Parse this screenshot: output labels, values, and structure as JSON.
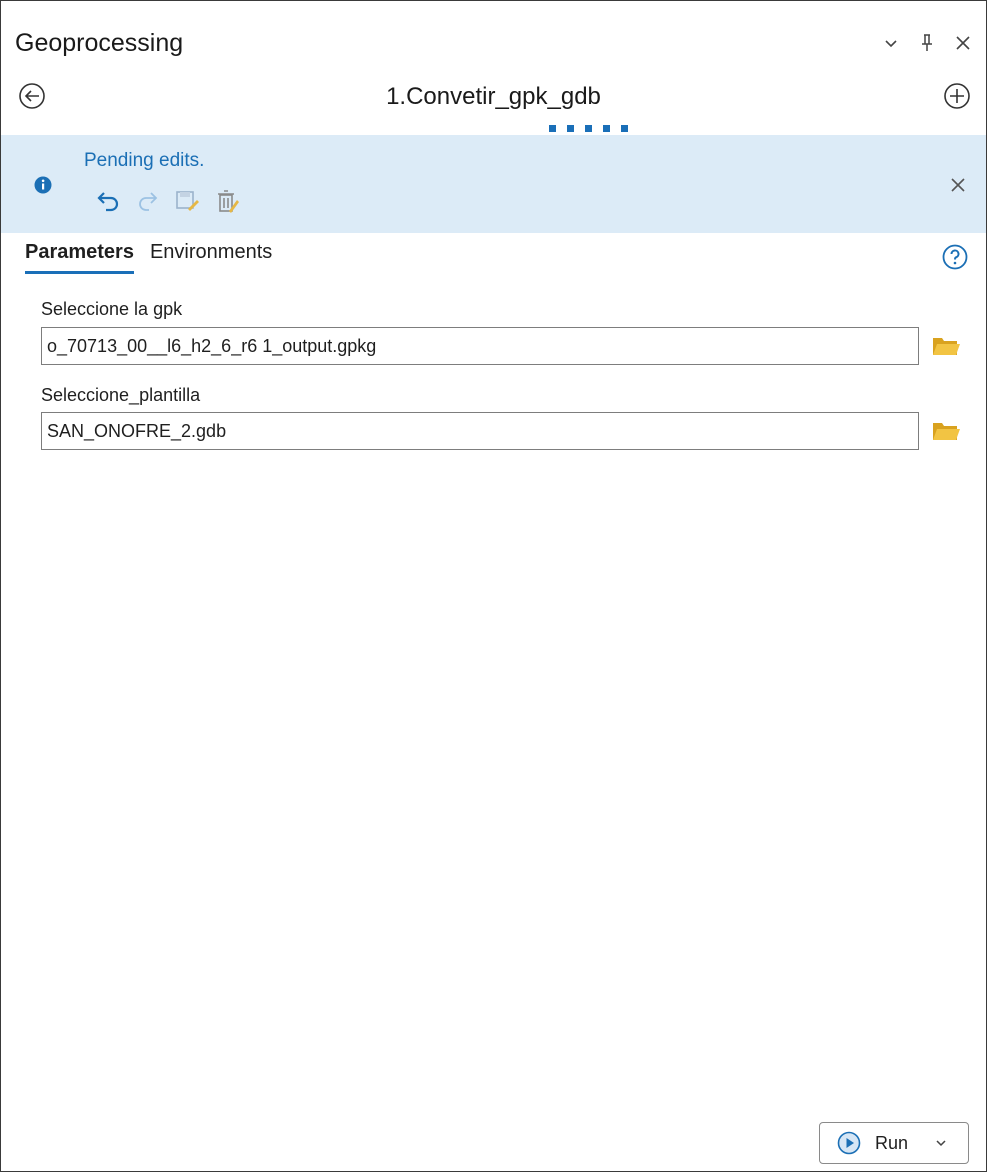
{
  "pane": {
    "title": "Geoprocessing",
    "controls": [
      {
        "icon": "chevron-down-icon",
        "glyph": "⌄"
      },
      {
        "icon": "pin-icon",
        "glyph": "⊥"
      },
      {
        "icon": "close-icon",
        "glyph": "×"
      }
    ]
  },
  "nav": {
    "tool_name": "1.Convetir_gpk_gdb",
    "back_icon": "back-arrow-icon",
    "add_icon": "add-icon"
  },
  "banner": {
    "message": "Pending edits.",
    "info_icon": "info-icon",
    "tools": [
      "undo-icon",
      "redo-icon",
      "save-edits-icon",
      "discard-edits-icon"
    ],
    "close_icon": "close-icon",
    "background": "#dcebf7",
    "text_color": "#1b6fb5"
  },
  "tabs": [
    {
      "label": "Parameters",
      "active": true
    },
    {
      "label": "Environments",
      "active": false
    }
  ],
  "help_icon": "help-icon",
  "parameters": [
    {
      "label": "Seleccione la gpk",
      "value": "o_70713_00__l6_h2_6_r6 1_output.gpkg",
      "browse_icon": "folder-icon"
    },
    {
      "label": "Seleccione_plantilla",
      "value": "SAN_ONOFRE_2.gdb",
      "browse_icon": "folder-icon"
    }
  ],
  "run_button": {
    "label": "Run",
    "icon": "play-icon",
    "dropdown_icon": "chevron-down-icon"
  },
  "colors": {
    "accent": "#1a6fb8",
    "folder": "#e9b633"
  }
}
